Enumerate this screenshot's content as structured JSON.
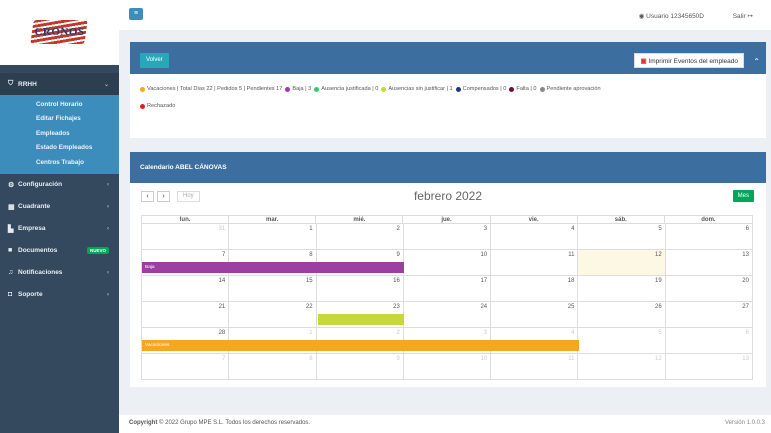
{
  "logo": {
    "text": "CRONOS"
  },
  "sidebar": {
    "rrhh_label": "RRHH",
    "subitems": [
      "Control Horario",
      "Editar Fichajes",
      "Empleados",
      "Estado Empleados",
      "Centros Trabajo"
    ],
    "items": [
      {
        "label": "Configuración",
        "icon": "gear-icon"
      },
      {
        "label": "Cuadrante",
        "icon": "calendar-icon"
      },
      {
        "label": "Empresa",
        "icon": "building-icon"
      },
      {
        "label": "Documentos",
        "icon": "document-icon",
        "badge": "NUEVO"
      },
      {
        "label": "Notificaciones",
        "icon": "bell-icon"
      },
      {
        "label": "Soporte",
        "icon": "support-icon"
      }
    ]
  },
  "topbar": {
    "user": "Usuario 12345650D",
    "logout": "Salir"
  },
  "events_panel": {
    "volver": "Volver",
    "print": "Imprimir Eventos del empleado",
    "legend": [
      {
        "text": "Vacaciones | Total Días 22 | Pedidos 5 | Pendientes 17",
        "color": "#f5a623"
      },
      {
        "text": "Baja | 3",
        "color": "#9b3fa0"
      },
      {
        "text": "Ausencia justificada | 0",
        "color": "#2ecc71"
      },
      {
        "text": "Ausencias sin justificar | 1",
        "color": "#c7d93a"
      },
      {
        "text": "Compensados | 0",
        "color": "#1f3a75"
      },
      {
        "text": "Falta | 0",
        "color": "#6a1040"
      },
      {
        "text": "Pendiente aprovación",
        "color": "#888888"
      },
      {
        "text": "Rechazado",
        "color": "#e02020"
      }
    ]
  },
  "calendar": {
    "title": "Calendario ABEL CÁNOVAS",
    "hoy": "Hoy",
    "month": "febrero 2022",
    "view": "Mes",
    "days_of_week": [
      "lun.",
      "mar.",
      "mié.",
      "jue.",
      "vie.",
      "sáb.",
      "dom."
    ],
    "weeks": [
      [
        "31",
        "1",
        "2",
        "3",
        "4",
        "5",
        "6"
      ],
      [
        "7",
        "8",
        "9",
        "10",
        "11",
        "12",
        "13"
      ],
      [
        "14",
        "15",
        "16",
        "17",
        "18",
        "19",
        "20"
      ],
      [
        "21",
        "22",
        "23",
        "24",
        "25",
        "26",
        "27"
      ],
      [
        "28",
        "1",
        "2",
        "3",
        "4",
        "5",
        "6"
      ],
      [
        "7",
        "8",
        "9",
        "10",
        "11",
        "12",
        "13"
      ]
    ],
    "events": [
      {
        "label": "Baja",
        "color": "#9b3fa0"
      },
      {
        "label": "",
        "color": "#c7d93a"
      },
      {
        "label": "Vacaciones",
        "color": "#f5a623"
      }
    ]
  },
  "footer": {
    "copyright_bold": "Copyright",
    "copyright_rest": "© 2022 Grupo MPE S.L. Todos los derechos reservados.",
    "version": "Versión 1.0.0.3"
  }
}
